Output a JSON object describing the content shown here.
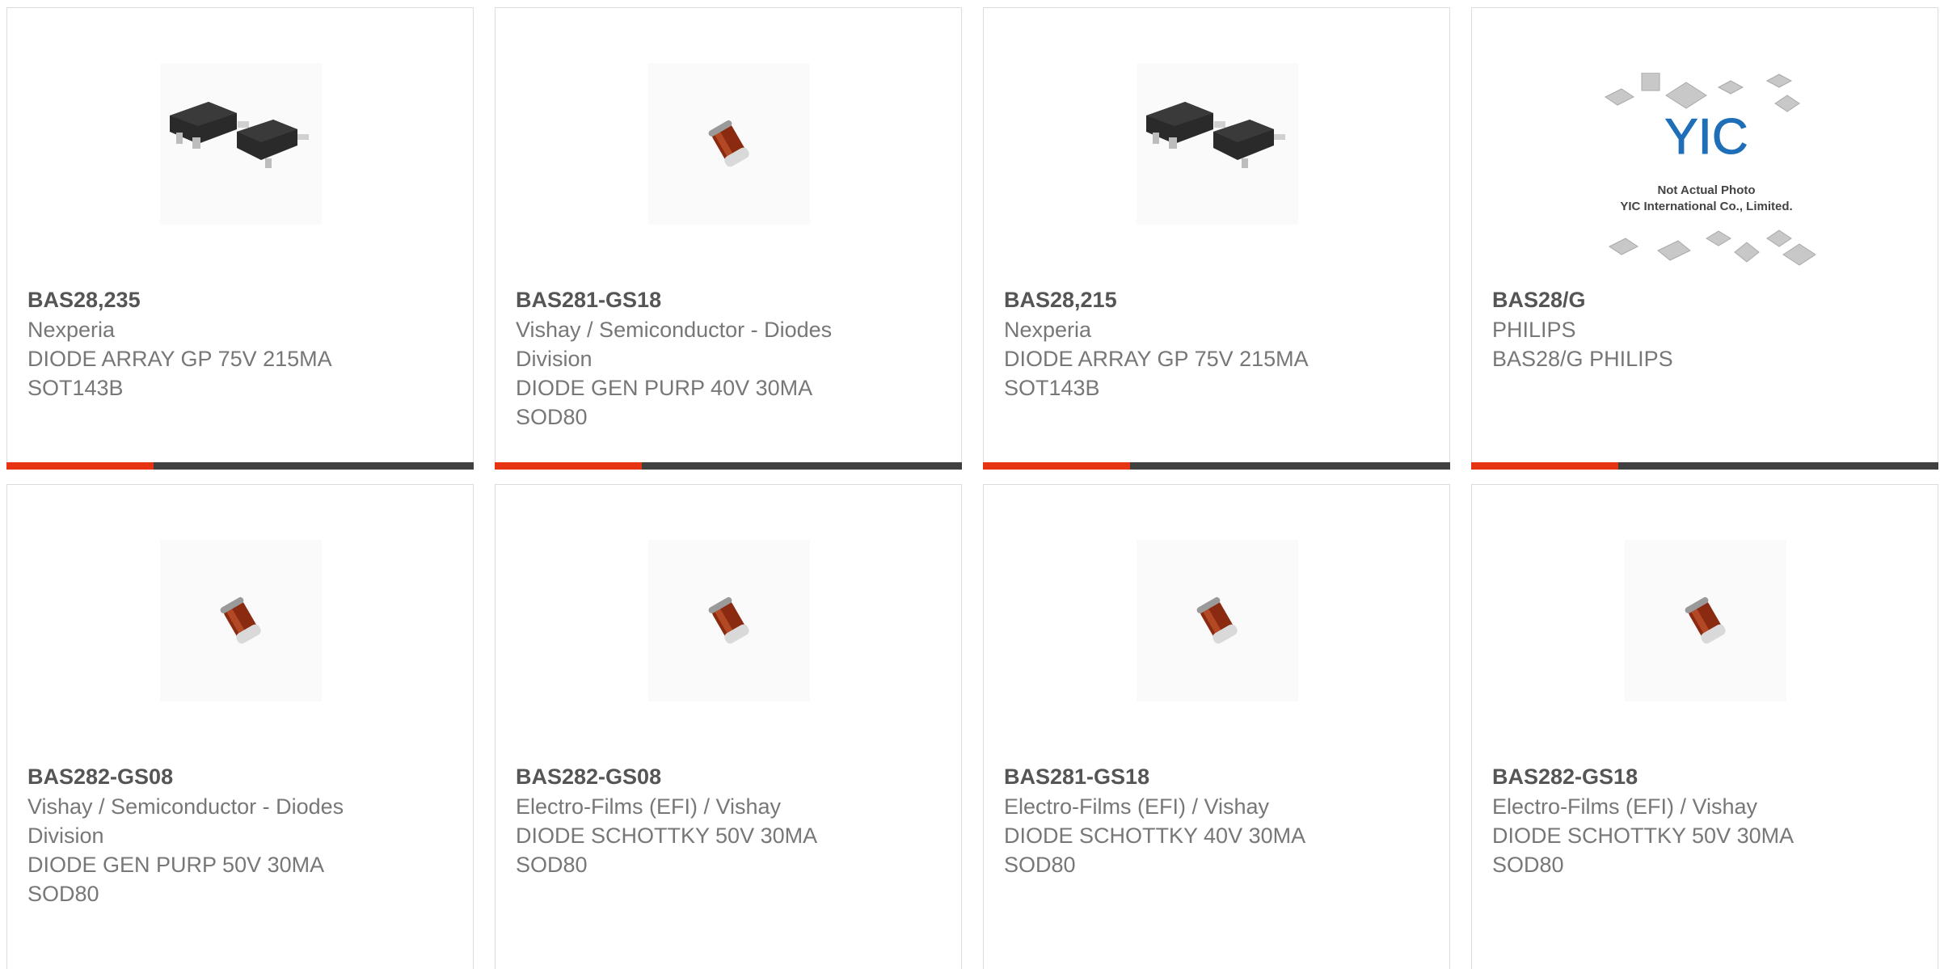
{
  "colors": {
    "accent": "#e63312",
    "bar": "#404040",
    "border": "#dcdcdc",
    "part_text": "#555555",
    "body_text": "#777777"
  },
  "cards": [
    {
      "part": "BAS28,235",
      "lines": [
        "Nexperia",
        "DIODE ARRAY GP 75V 215MA",
        "SOT143B"
      ],
      "image": "sot143-package-icon"
    },
    {
      "part": "BAS281-GS18",
      "lines": [
        "Vishay / Semiconductor - Diodes",
        "Division",
        "DIODE GEN PURP 40V 30MA",
        "SOD80"
      ],
      "image": "sod80-diode-icon"
    },
    {
      "part": "BAS28,215",
      "lines": [
        "Nexperia",
        "DIODE ARRAY GP 75V 215MA",
        "SOT143B"
      ],
      "image": "sot143-package-icon"
    },
    {
      "part": "BAS28/G",
      "lines": [
        "PHILIPS",
        "BAS28/G PHILIPS"
      ],
      "image": "placeholder-photo",
      "placeholder": {
        "logo": "YIC",
        "line1": "Not Actual Photo",
        "line2": "YIC International Co., Limited."
      }
    },
    {
      "part": "BAS282-GS08",
      "lines": [
        "Vishay / Semiconductor - Diodes",
        "Division",
        "DIODE GEN PURP 50V 30MA",
        "SOD80"
      ],
      "image": "sod80-diode-icon"
    },
    {
      "part": "BAS282-GS08",
      "lines": [
        "Electro-Films (EFI) / Vishay",
        "DIODE SCHOTTKY 50V 30MA",
        "SOD80"
      ],
      "image": "sod80-diode-icon"
    },
    {
      "part": "BAS281-GS18",
      "lines": [
        "Electro-Films (EFI) / Vishay",
        "DIODE SCHOTTKY 40V 30MA",
        "SOD80"
      ],
      "image": "sod80-diode-icon"
    },
    {
      "part": "BAS282-GS18",
      "lines": [
        "Electro-Films (EFI) / Vishay",
        "DIODE SCHOTTKY 50V 30MA",
        "SOD80"
      ],
      "image": "sod80-diode-icon"
    }
  ]
}
